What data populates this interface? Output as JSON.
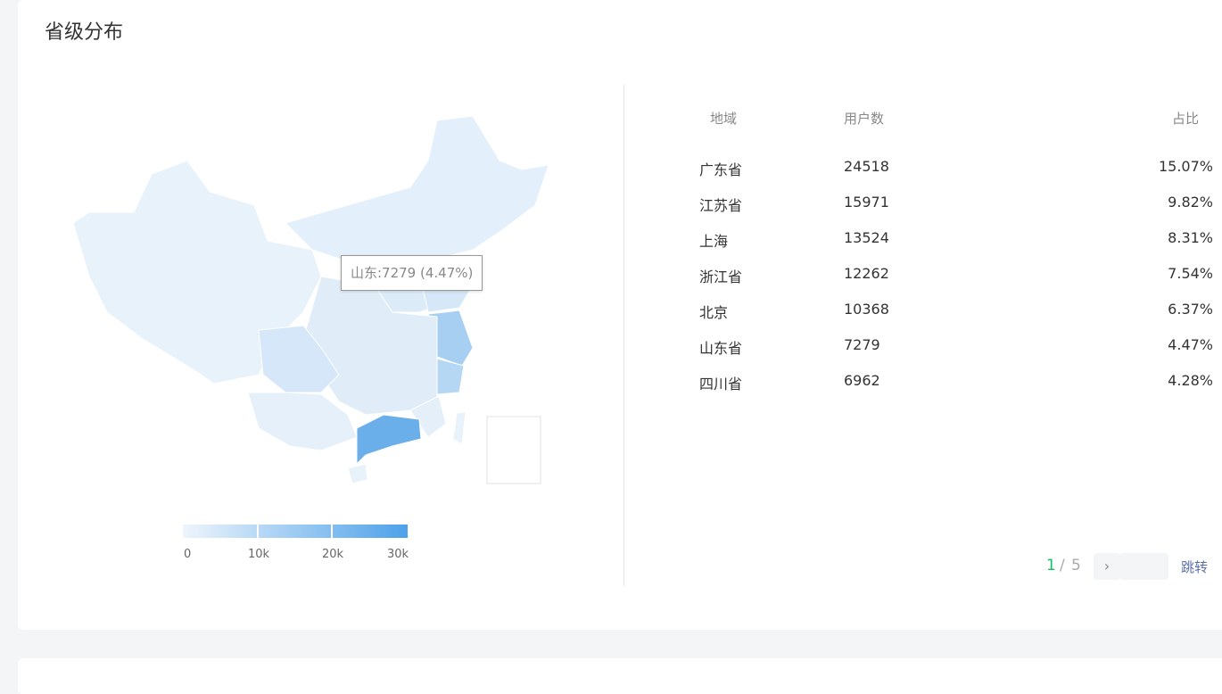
{
  "title": "省级分布",
  "tooltip": "山东:7279 (4.47%)",
  "legend": {
    "ticks": [
      "0",
      "10k",
      "20k",
      "30k"
    ],
    "min_color": "#eef5fc",
    "max_color": "#4da1e9"
  },
  "table": {
    "headers": [
      "地域",
      "用户数",
      "占比"
    ],
    "rows": [
      {
        "region": "广东省",
        "users": "24518",
        "ratio": "15.07%"
      },
      {
        "region": "江苏省",
        "users": "15971",
        "ratio": "9.82%"
      },
      {
        "region": "上海",
        "users": "13524",
        "ratio": "8.31%"
      },
      {
        "region": "浙江省",
        "users": "12262",
        "ratio": "7.54%"
      },
      {
        "region": "北京",
        "users": "10368",
        "ratio": "6.37%"
      },
      {
        "region": "山东省",
        "users": "7279",
        "ratio": "4.47%"
      },
      {
        "region": "四川省",
        "users": "6962",
        "ratio": "4.28%"
      }
    ]
  },
  "pagination": {
    "current": "1",
    "separator": "/",
    "total": "5",
    "next": "›",
    "jump_label": "跳转",
    "accent": "#19be6b"
  }
}
